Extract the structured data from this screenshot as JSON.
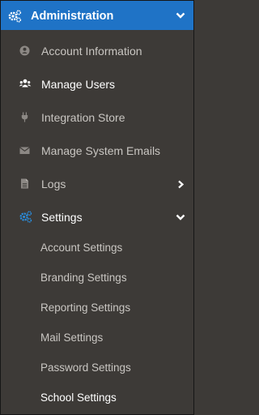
{
  "header": {
    "title": "Administration",
    "icon": "cogs-icon",
    "chevron": "chevron-down-icon",
    "accent": "#1f73c6"
  },
  "menu": {
    "items": [
      {
        "label": "Account Information",
        "icon": "user-circle-icon"
      },
      {
        "label": "Manage Users",
        "icon": "users-icon"
      },
      {
        "label": "Integration Store",
        "icon": "plug-icon"
      },
      {
        "label": "Manage System Emails",
        "icon": "envelope-icon"
      },
      {
        "label": "Logs",
        "icon": "file-icon"
      },
      {
        "label": "Settings",
        "icon": "cogs-icon"
      }
    ],
    "settings_sub": [
      {
        "label": "Account Settings"
      },
      {
        "label": "Branding Settings"
      },
      {
        "label": "Reporting Settings"
      },
      {
        "label": "Mail Settings"
      },
      {
        "label": "Password Settings"
      },
      {
        "label": "School Settings"
      }
    ]
  }
}
